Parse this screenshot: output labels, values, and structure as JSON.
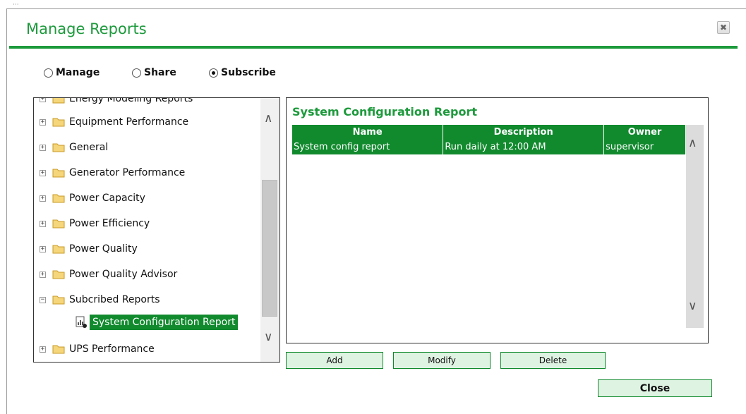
{
  "background_text": "···",
  "dialog": {
    "title": "Manage Reports",
    "close_icon": "✖"
  },
  "modes": [
    {
      "label": "Manage",
      "selected": false
    },
    {
      "label": "Share",
      "selected": false
    },
    {
      "label": "Subscribe",
      "selected": true
    }
  ],
  "tree": {
    "partial_top": "Energy Modeling Reports",
    "items": [
      {
        "label": "Equipment Performance",
        "expander": "+"
      },
      {
        "label": "General",
        "expander": "+"
      },
      {
        "label": "Generator Performance",
        "expander": "+"
      },
      {
        "label": "Power Capacity",
        "expander": "+"
      },
      {
        "label": "Power Efficiency",
        "expander": "+"
      },
      {
        "label": "Power Quality",
        "expander": "+"
      },
      {
        "label": "Power Quality Advisor",
        "expander": "+"
      },
      {
        "label": "Subcribed Reports",
        "expander": "−"
      },
      {
        "label": "UPS Performance",
        "expander": "+"
      }
    ],
    "selected_child": "System Configuration Report"
  },
  "report": {
    "title": "System Configuration Report",
    "columns": [
      "Name",
      "Description",
      "Owner"
    ],
    "rows": [
      {
        "name": "System config report",
        "description": "Run daily at 12:00 AM",
        "owner": "supervisor"
      }
    ]
  },
  "buttons": {
    "add": "Add",
    "modify": "Modify",
    "delete": "Delete",
    "close": "Close"
  },
  "icons": {
    "up": "∧",
    "down": "∨"
  },
  "colors": {
    "accent": "#1d9a3c",
    "selection": "#118a2e",
    "button_fill": "#dff3e2"
  }
}
